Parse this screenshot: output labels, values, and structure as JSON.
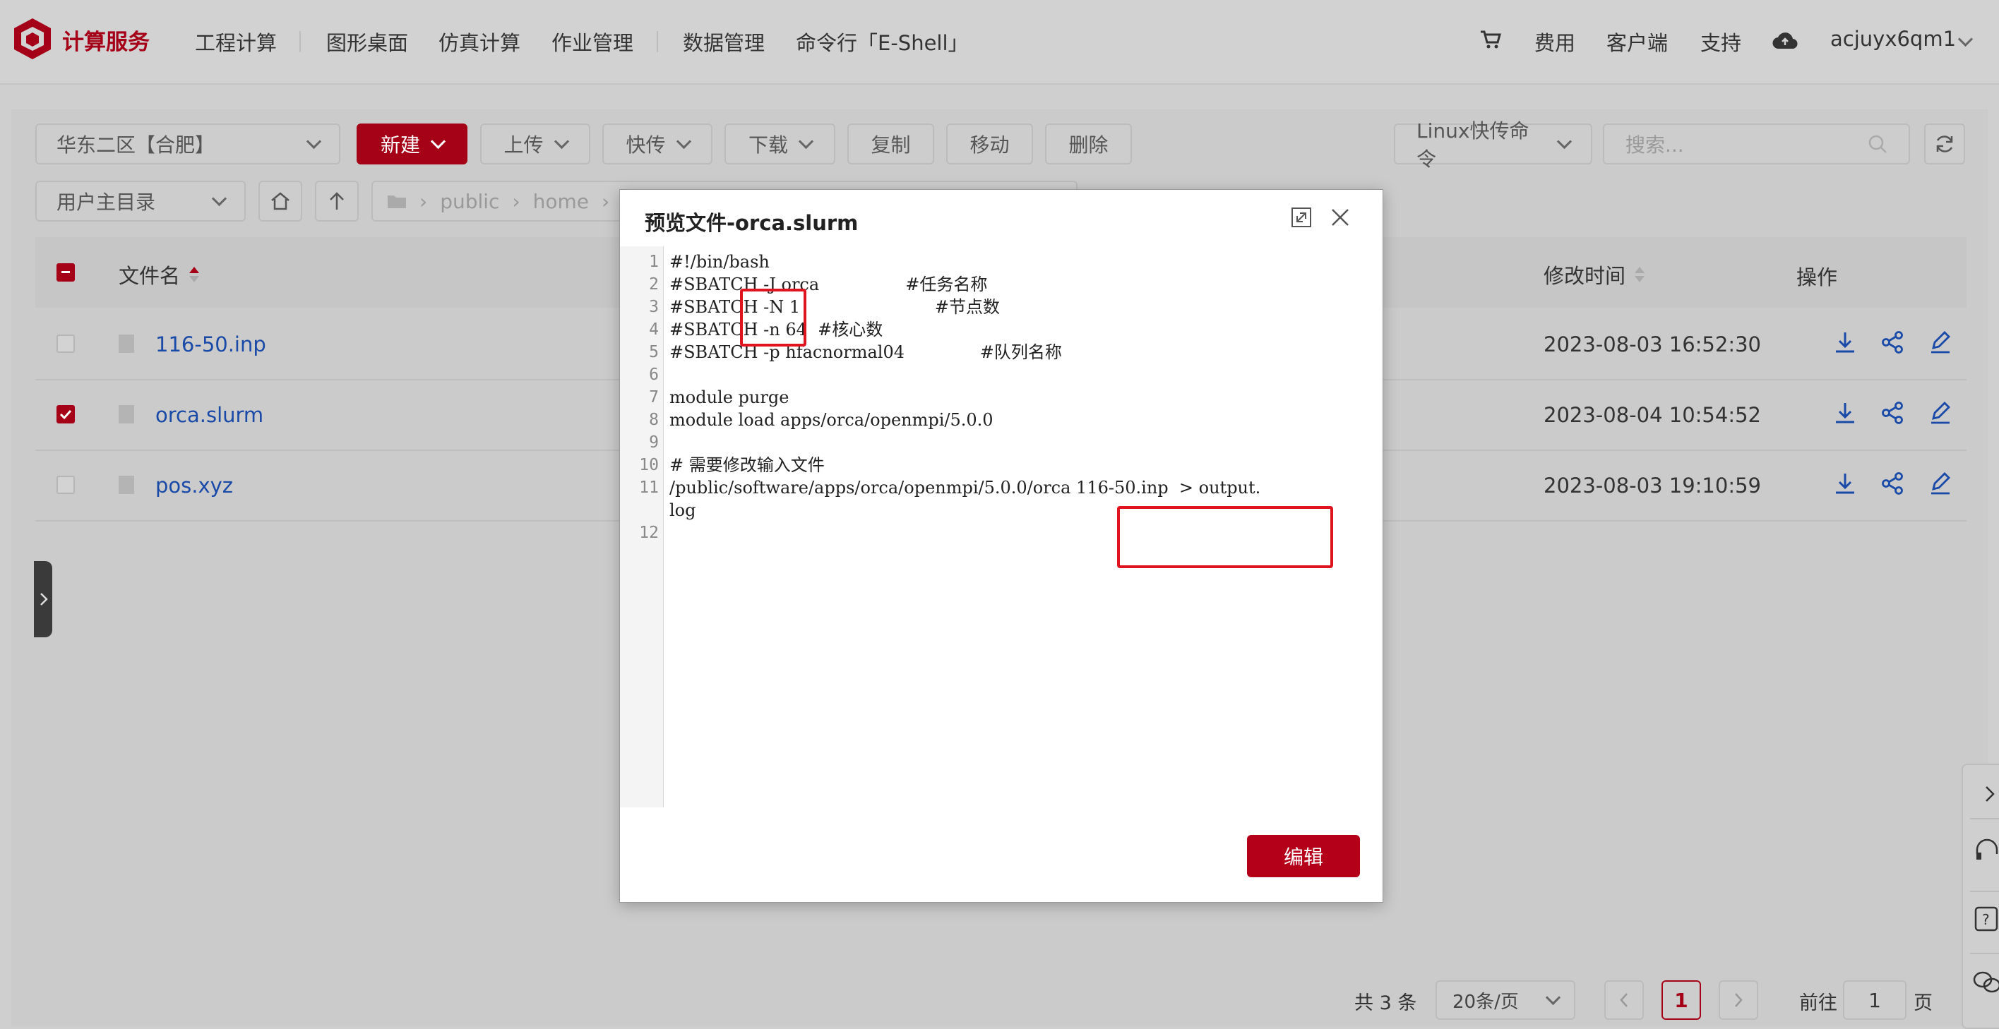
{
  "header": {
    "logo_text": "计算服务",
    "nav": [
      "工程计算",
      "图形桌面",
      "仿真计算",
      "作业管理",
      "数据管理",
      "命令行「E-Shell」"
    ],
    "fee": "费用",
    "client": "客户端",
    "support": "支持",
    "username": "acjuyx6qm1"
  },
  "toolbar": {
    "region": "华东二区【合肥】",
    "new": "新建",
    "upload": "上传",
    "fast_transfer": "快传",
    "download": "下载",
    "copy": "复制",
    "move": "移动",
    "delete": "删除",
    "linux_cmd": "Linux快传命令",
    "search_placeholder": "搜索..."
  },
  "pathbar": {
    "home_dir": "用户主目录",
    "crumbs": [
      "public",
      "home"
    ]
  },
  "table": {
    "col_name": "文件名",
    "col_mtime": "修改时间",
    "col_ops": "操作",
    "rows": [
      {
        "name": "116-50.inp",
        "mtime": "2023-08-03 16:52:30",
        "checked": false
      },
      {
        "name": "orca.slurm",
        "mtime": "2023-08-04 10:54:52",
        "checked": true
      },
      {
        "name": "pos.xyz",
        "mtime": "2023-08-03 19:10:59",
        "checked": false
      }
    ]
  },
  "pagination": {
    "total": "共 3 条",
    "page_size": "20条/页",
    "current": "1",
    "goto_label": "前往",
    "goto_value": "1",
    "page_unit": "页"
  },
  "modal": {
    "title": "预览文件-orca.slurm",
    "edit": "编辑",
    "line_numbers": [
      "1",
      "2",
      "3",
      "4",
      "5",
      "6",
      "7",
      "8",
      "9",
      "10",
      "11",
      "",
      "12"
    ],
    "lines": [
      "#!/bin/bash",
      "#SBATCH -J orca                #任务名称",
      "#SBATCH -N 1                         #节点数",
      "#SBATCH -n 64  #核心数",
      "#SBATCH -p hfacnormal04              #队列名称",
      "",
      "module purge",
      "module load apps/orca/openmpi/5.0.0",
      "",
      "# 需要修改输入文件",
      "/public/software/apps/orca/openmpi/5.0.0/orca 116-50.inp  > output.",
      "log",
      ""
    ]
  },
  "colors": {
    "accent": "#a50117",
    "link": "#1a4aa8",
    "highlight": "#e0141e"
  }
}
